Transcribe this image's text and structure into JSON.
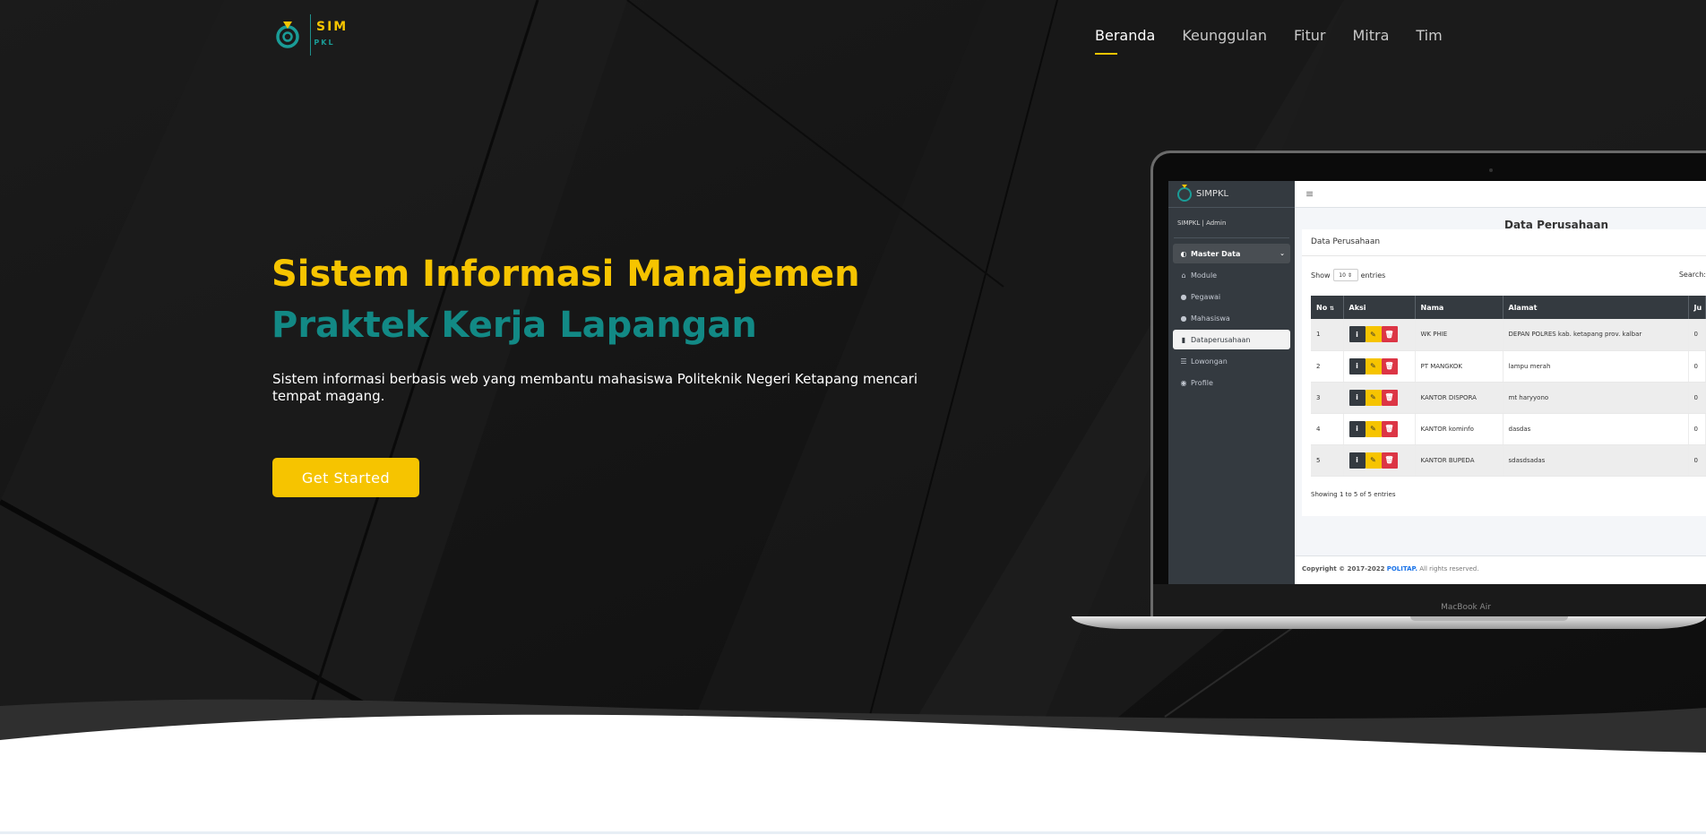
{
  "brand": {
    "name_part1": "SIM",
    "name_part2": "PKL",
    "logo_icon": "simpkl-logo-icon"
  },
  "nav": {
    "items": [
      {
        "label": "Beranda",
        "active": true
      },
      {
        "label": "Keunggulan",
        "active": false
      },
      {
        "label": "Fitur",
        "active": false
      },
      {
        "label": "Mitra",
        "active": false
      },
      {
        "label": "Tim",
        "active": false
      }
    ]
  },
  "hero": {
    "title_line1": "Sistem Informasi Manajemen",
    "title_line2": "Praktek Kerja Lapangan",
    "lead": "Sistem informasi berbasis web yang membantu mahasiswa Politeknik Negeri Ketapang mencari tempat magang.",
    "cta_label": "Get Started"
  },
  "colors": {
    "accent_yellow": "#f6c400",
    "accent_teal": "#128985",
    "background_dark": "#141414"
  },
  "laptop": {
    "model_label": "MacBook Air",
    "app": {
      "brand": "SIMPKL",
      "user": "SIMPKL | Admin",
      "menu_toggle": "≡",
      "menu": [
        {
          "label": "Master Data",
          "icon": "dashboard-icon",
          "type": "group"
        },
        {
          "label": "Module",
          "icon": "home-icon",
          "type": "item"
        },
        {
          "label": "Pegawai",
          "icon": "user-icon",
          "type": "item"
        },
        {
          "label": "Mahasiswa",
          "icon": "users-icon",
          "type": "item"
        },
        {
          "label": "Dataperusahaan",
          "icon": "building-icon",
          "type": "active"
        },
        {
          "label": "Lowongan",
          "icon": "list-icon",
          "type": "item"
        },
        {
          "label": "Profile",
          "icon": "user-circle-icon",
          "type": "item"
        }
      ],
      "page_title": "Data Perusahaan",
      "card_title": "Data Perusahaan",
      "show_label": "Show",
      "show_value": "10",
      "entries_label": "entries",
      "search_label": "Search:",
      "columns": [
        "No",
        "Aksi",
        "Nama",
        "Alamat",
        "Ju"
      ],
      "rows": [
        {
          "no": "1",
          "nama": "WK PHIE",
          "alamat": "DEPAN POLRES kab. ketapang prov. kalbar",
          "ju": "0"
        },
        {
          "no": "2",
          "nama": "PT MANGKOK",
          "alamat": "lampu merah",
          "ju": "0"
        },
        {
          "no": "3",
          "nama": "KANTOR DISPORA",
          "alamat": "mt haryyono",
          "ju": "0"
        },
        {
          "no": "4",
          "nama": "KANTOR kominfo",
          "alamat": "dasdas",
          "ju": "0"
        },
        {
          "no": "5",
          "nama": "KANTOR BUPEDA",
          "alamat": "sdasdsadas",
          "ju": "0"
        }
      ],
      "action_buttons": {
        "info": "i",
        "edit": "✎",
        "delete": "🗑"
      },
      "showing_text": "Showing 1 to 5 of 5 entries",
      "footer": {
        "copyright": "Copyright © 2017-2022",
        "org": "POLITAP.",
        "rights": "All rights reserved."
      }
    }
  }
}
